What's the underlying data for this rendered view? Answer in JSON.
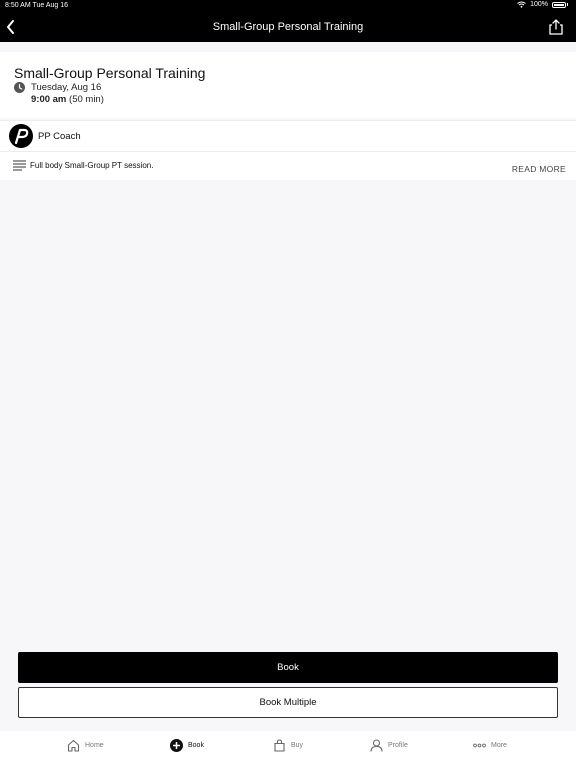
{
  "status_bar": {
    "time": "8:50 AM  Tue Aug 16",
    "battery": "100%"
  },
  "nav": {
    "title": "Small-Group Personal Training"
  },
  "session": {
    "title": "Small-Group Personal Training",
    "date": "Tuesday, Aug 16",
    "time": "9:00 am",
    "duration": "(50 min)"
  },
  "coach": {
    "name": "PP Coach"
  },
  "description": {
    "text": "Full body Small-Group PT session.",
    "read_more": "READ MORE"
  },
  "actions": {
    "book": "Book",
    "book_multiple": "Book Multiple"
  },
  "tabs": [
    {
      "label": "Home",
      "icon": "home-icon"
    },
    {
      "label": "Book",
      "icon": "plus-circle-icon"
    },
    {
      "label": "Buy",
      "icon": "shopping-bag-icon"
    },
    {
      "label": "Profile",
      "icon": "person-icon"
    },
    {
      "label": "More",
      "icon": "more-dots-icon"
    }
  ]
}
